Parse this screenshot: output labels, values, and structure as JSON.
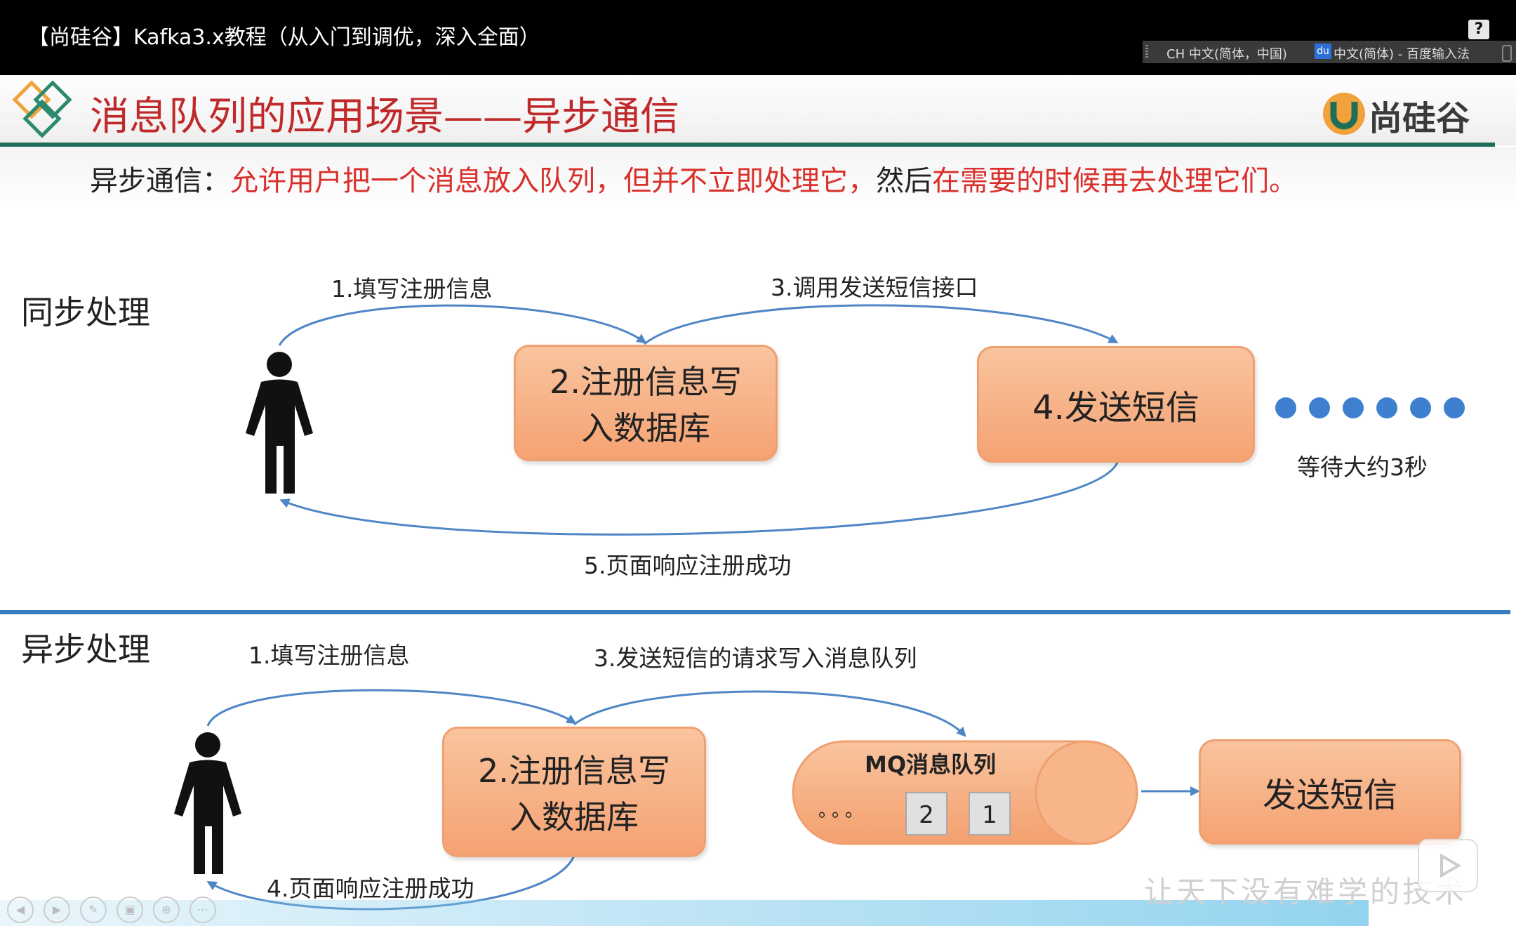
{
  "player": {
    "title": "【尚硅谷】Kafka3.x教程（从入门到调优，深入全面）",
    "help": "?",
    "ime_item1": "CH 中文(简体，中国)",
    "ime_du": "du",
    "ime_item2": "中文(简体) - 百度输入法"
  },
  "slide": {
    "title": "消息队列的应用场景——异步通信",
    "brand": "尚硅谷",
    "subtitle_prefix": "异步通信：",
    "subtitle_part1": "允许用户把一个消息放入队列，",
    "subtitle_part2": "但并不立即处理它，",
    "subtitle_part3": "然后",
    "subtitle_part4": "在需要的时候再去处理它们。",
    "watermark": "让天下没有难学的技术"
  },
  "sync": {
    "label": "同步处理",
    "step1": "1.填写注册信息",
    "step3": "3.调用发送短信接口",
    "box2_line1": "2.注册信息写",
    "box2_line2": "入数据库",
    "box4": "4.发送短信",
    "wait": "等待大约3秒",
    "step5": "5.页面响应注册成功"
  },
  "async": {
    "label": "异步处理",
    "step1": "1.填写注册信息",
    "step3": "3.发送短信的请求写入消息队列",
    "box2_line1": "2.注册信息写",
    "box2_line2": "入数据库",
    "mq_label": "MQ消息队列",
    "mq_dots": "。。。",
    "mq_cell2": "2",
    "mq_cell1": "1",
    "send_box": "发送短信",
    "step4": "4.页面响应注册成功"
  },
  "colors": {
    "title_red": "#c0292a",
    "box_orange": "#f5a272",
    "arrow_blue": "#4f86c6",
    "divider_blue": "#3a7cc0",
    "header_green": "#1f6e5a"
  }
}
